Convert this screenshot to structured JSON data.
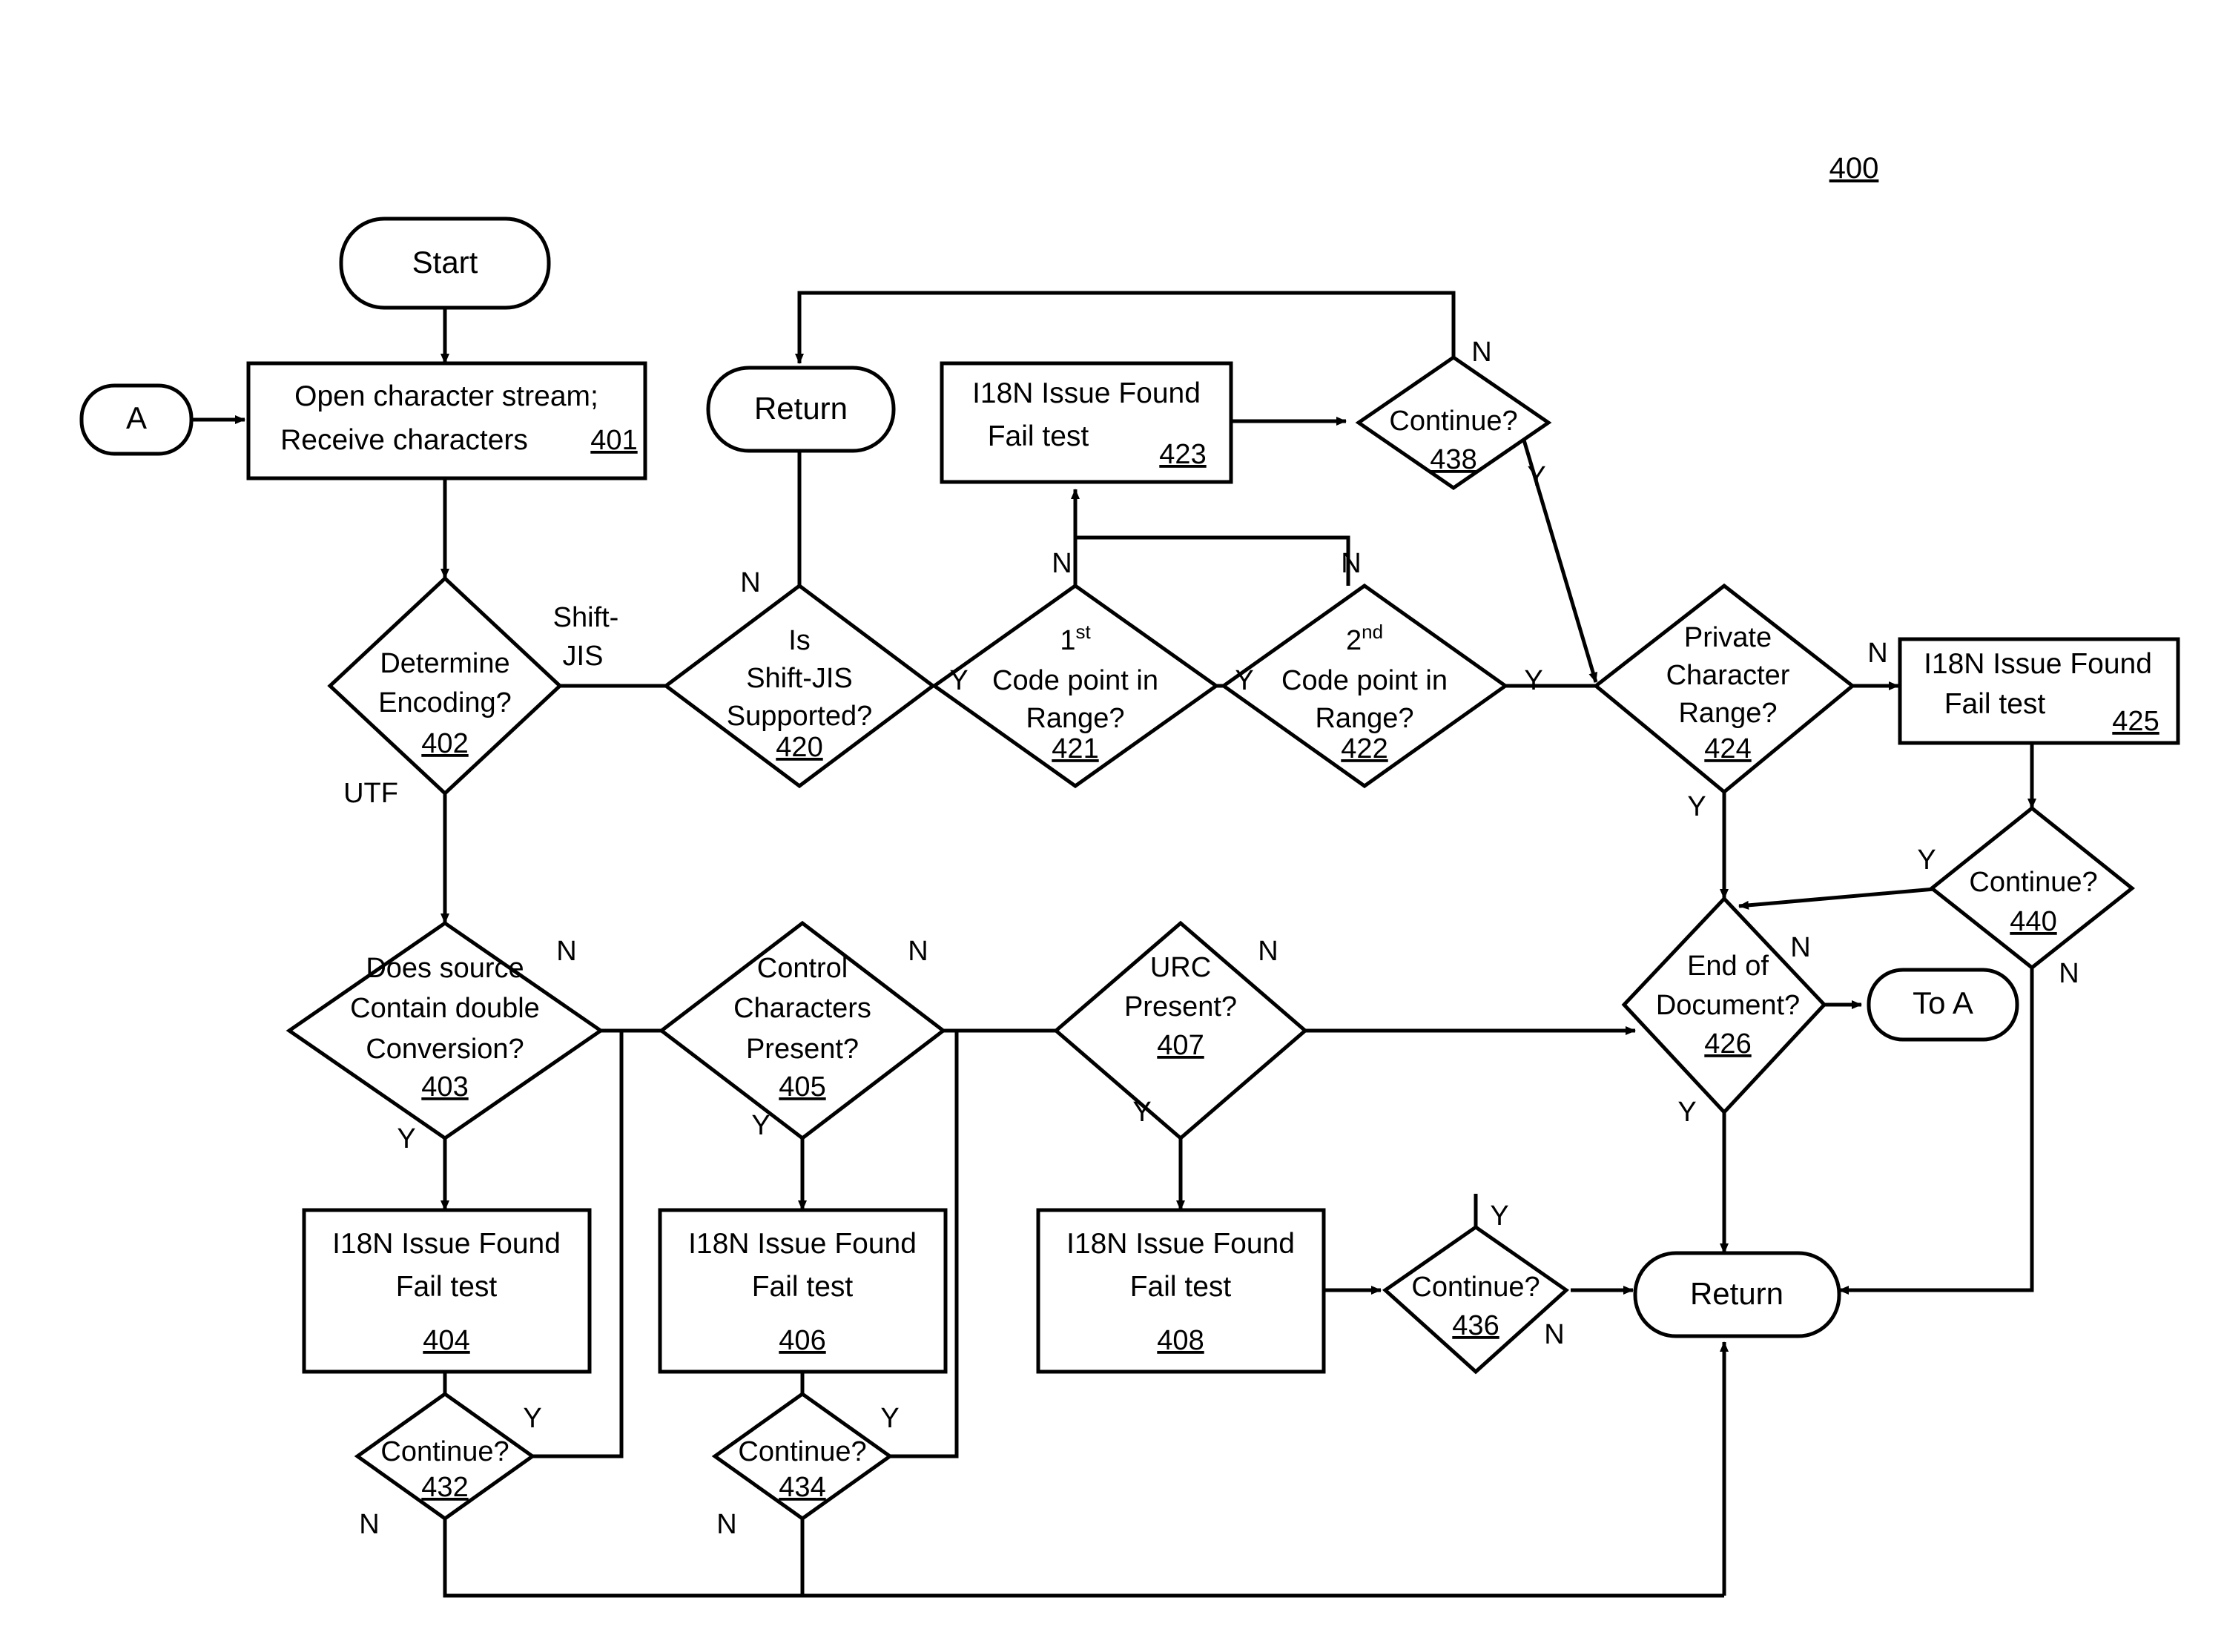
{
  "figure": {
    "number": "400"
  },
  "nodes": {
    "start": {
      "label": "Start",
      "type": "terminator"
    },
    "connector_a": {
      "label": "A",
      "type": "connector"
    },
    "open_stream": {
      "line1": "Open character stream;",
      "line2": "Receive characters",
      "ref": "401",
      "type": "process"
    },
    "return_top": {
      "label": "Return",
      "type": "terminator"
    },
    "issue_423": {
      "line1": "I18N Issue Found",
      "line2": "Fail test",
      "ref": "423",
      "type": "process"
    },
    "continue_438": {
      "label": "Continue?",
      "ref": "438",
      "type": "decision"
    },
    "determine_encoding": {
      "line1": "Determine",
      "line2": "Encoding?",
      "ref": "402",
      "type": "decision"
    },
    "shift_jis_supported": {
      "line1": "Is",
      "line2": "Shift-JIS",
      "line3": "Supported?",
      "ref": "420",
      "type": "decision"
    },
    "code_point_1": {
      "line1": "1",
      "line1_sup": "st",
      "line2": "Code point in",
      "line3": "Range?",
      "ref": "421",
      "type": "decision"
    },
    "code_point_2": {
      "line1": "2",
      "line1_sup": "nd",
      "line2": "Code point in",
      "line3": "Range?",
      "ref": "422",
      "type": "decision"
    },
    "private_char_range": {
      "line1": "Private",
      "line2": "Character",
      "line3": "Range?",
      "ref": "424",
      "type": "decision"
    },
    "issue_425": {
      "line1": "I18N Issue Found",
      "line2": "Fail test",
      "ref": "425",
      "type": "process"
    },
    "continue_440": {
      "label": "Continue?",
      "ref": "440",
      "type": "decision"
    },
    "double_conversion": {
      "line1": "Does source",
      "line2": "Contain double",
      "line3": "Conversion?",
      "ref": "403",
      "type": "decision"
    },
    "control_chars": {
      "line1": "Control",
      "line2": "Characters",
      "line3": "Present?",
      "ref": "405",
      "type": "decision"
    },
    "urc_present": {
      "line1": "URC",
      "line2": "Present?",
      "ref": "407",
      "type": "decision"
    },
    "end_of_document": {
      "line1": "End of",
      "line2": "Document?",
      "ref": "426",
      "type": "decision"
    },
    "to_a": {
      "label": "To A",
      "type": "connector"
    },
    "issue_404": {
      "line1": "I18N Issue Found",
      "line2": "Fail test",
      "ref": "404",
      "type": "process"
    },
    "issue_406": {
      "line1": "I18N Issue Found",
      "line2": "Fail test",
      "ref": "406",
      "type": "process"
    },
    "issue_408": {
      "line1": "I18N Issue Found",
      "line2": "Fail test",
      "ref": "408",
      "type": "process"
    },
    "continue_436": {
      "label": "Continue?",
      "ref": "436",
      "type": "decision"
    },
    "continue_432": {
      "label": "Continue?",
      "ref": "432",
      "type": "decision"
    },
    "continue_434": {
      "label": "Continue?",
      "ref": "434",
      "type": "decision"
    },
    "return_bottom": {
      "label": "Return",
      "type": "terminator"
    }
  },
  "edge_labels": {
    "encoding_shift_jis_1": "Shift-",
    "encoding_shift_jis_2": "JIS",
    "encoding_utf": "UTF",
    "jis420_n": "N",
    "jis420_y": "Y",
    "cp421_n": "N",
    "cp421_y": "Y",
    "cp422_n": "N",
    "cp422_y": "Y",
    "c438_n": "N",
    "c438_y": "Y",
    "pcr424_n": "N",
    "pcr424_y": "Y",
    "c440_y": "Y",
    "c440_n": "N",
    "dc403_n": "N",
    "dc403_y": "Y",
    "cc405_n": "N",
    "cc405_y": "Y",
    "urc407_n": "N",
    "urc407_y": "Y",
    "eod426_n": "N",
    "eod426_y": "Y",
    "c436_y": "Y",
    "c436_n": "N",
    "c432_y": "Y",
    "c432_n": "N",
    "c434_y": "Y",
    "c434_n": "N"
  },
  "colors": {
    "stroke": "#000000",
    "fill": "#ffffff"
  }
}
